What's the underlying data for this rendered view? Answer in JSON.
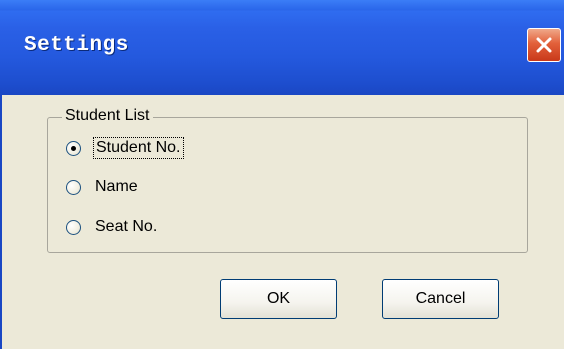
{
  "window": {
    "title": "Settings",
    "close_icon": "close-icon"
  },
  "group": {
    "legend": "Student List",
    "options": [
      {
        "label": "Student No.",
        "selected": true
      },
      {
        "label": "Name",
        "selected": false
      },
      {
        "label": "Seat No.",
        "selected": false
      }
    ]
  },
  "buttons": {
    "ok_label": "OK",
    "cancel_label": "Cancel"
  },
  "colors": {
    "titlebar": "#2459de",
    "close_button": "#e2603a",
    "dialog_background": "#ece9d8"
  }
}
